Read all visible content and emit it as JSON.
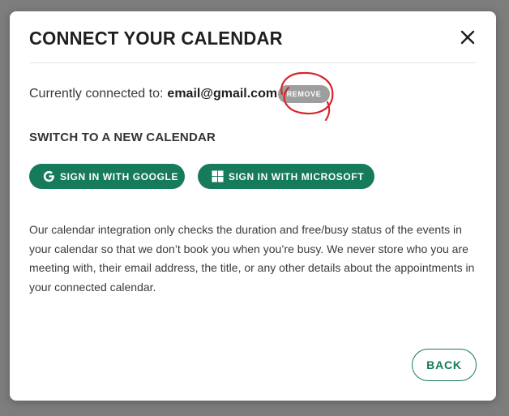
{
  "modal": {
    "title": "CONNECT YOUR CALENDAR",
    "close_icon": "close-icon"
  },
  "connection": {
    "prefix": "Currently connected to:",
    "email": "email@gmail.com",
    "remove_label": "REMOVE",
    "annotation_color": "#d9232b"
  },
  "switch_section": {
    "title": "SWITCH TO A NEW CALENDAR",
    "google_label": "SIGN IN WITH GOOGLE",
    "google_icon": "google-icon",
    "microsoft_label": "SIGN IN WITH MICROSOFT",
    "microsoft_icon": "windows-icon"
  },
  "description": "Our calendar integration only checks the duration and free/busy status of the events in your calendar so that we don’t book you when you’re busy. We never store who you are meeting with, their email address, the title, or any other details about the appointments in your connected calendar.",
  "footer": {
    "back_label": "BACK"
  },
  "colors": {
    "primary": "#167a5c",
    "remove_bg": "#9e9e9e",
    "overlay": "#7d7d7d"
  }
}
